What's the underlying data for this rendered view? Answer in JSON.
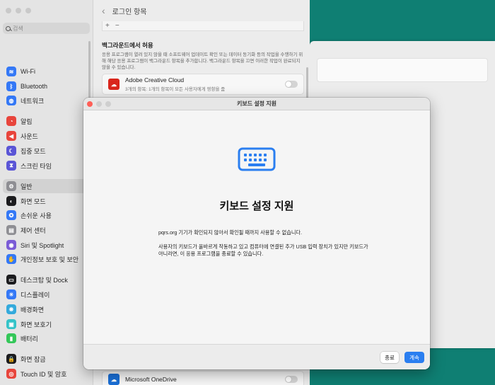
{
  "settings": {
    "search_placeholder": "검색",
    "header_title": "로그인 항목",
    "list_controls": {
      "add": "+",
      "remove": "−"
    },
    "sidebar_items": [
      {
        "label": "Wi-Fi",
        "icon": "wifi-icon",
        "color": "#3478f6",
        "glyph": "≋"
      },
      {
        "label": "Bluetooth",
        "icon": "bluetooth-icon",
        "color": "#3478f6",
        "glyph": "ᛒ"
      },
      {
        "label": "네트워크",
        "icon": "globe-icon",
        "color": "#3478f6",
        "glyph": "◍"
      },
      {
        "label": "알림",
        "icon": "bell-icon",
        "color": "#e8453c",
        "glyph": "◔"
      },
      {
        "label": "사운드",
        "icon": "speaker-icon",
        "color": "#e8453c",
        "glyph": "◀"
      },
      {
        "label": "집중 모드",
        "icon": "moon-icon",
        "color": "#5a55d6",
        "glyph": "☾"
      },
      {
        "label": "스크린 타임",
        "icon": "hourglass-icon",
        "color": "#5a55d6",
        "glyph": "⧗"
      },
      {
        "label": "일반",
        "icon": "gear-icon",
        "color": "#8e8e93",
        "glyph": "⚙"
      },
      {
        "label": "화면 모드",
        "icon": "appearance-icon",
        "color": "#1c1c1e",
        "glyph": "◐"
      },
      {
        "label": "손쉬운 사용",
        "icon": "accessibility-icon",
        "color": "#3478f6",
        "glyph": "✪"
      },
      {
        "label": "제어 센터",
        "icon": "control-center-icon",
        "color": "#8e8e93",
        "glyph": "▤"
      },
      {
        "label": "Siri 및 Spotlight",
        "icon": "siri-icon",
        "color": "#7b5cd6",
        "glyph": "◉"
      },
      {
        "label": "개인정보 보호 및 보안",
        "icon": "hand-icon",
        "color": "#3478f6",
        "glyph": "✋"
      },
      {
        "label": "데스크탑 및 Dock",
        "icon": "dock-icon",
        "color": "#1c1c1e",
        "glyph": "▭"
      },
      {
        "label": "디스플레이",
        "icon": "display-icon",
        "color": "#3478f6",
        "glyph": "☀"
      },
      {
        "label": "배경화면",
        "icon": "wallpaper-icon",
        "color": "#34aadc",
        "glyph": "❋"
      },
      {
        "label": "화면 보호기",
        "icon": "screensaver-icon",
        "color": "#34c3c8",
        "glyph": "▣"
      },
      {
        "label": "배터리",
        "icon": "battery-icon",
        "color": "#34c759",
        "glyph": "▮"
      },
      {
        "label": "화면 잠금",
        "icon": "lock-icon",
        "color": "#1c1c1e",
        "glyph": "🔒"
      },
      {
        "label": "Touch ID 및 암호",
        "icon": "fingerprint-icon",
        "color": "#e8453c",
        "glyph": "◎"
      }
    ],
    "background_section": {
      "title": "백그라운드에서 허용",
      "description": "응용 프로그램이 열려 있지 않을 때 소프트웨어 업데이트 확인 또는 데이터 동기화 등의 작업을 수행하기 위해 해당 응용 프로그램이 백그라운드 항목을 추가합니다. 백그라운드 항목을 끄면 이러한 작업이 완료되지 않을 수 있습니다."
    },
    "adobe_item": {
      "name": "Adobe Creative Cloud",
      "detail": "3개의 항목: 1개의 항목이 모든 사용자에게 영향을 줌",
      "icon": "adobe-icon",
      "color": "#d9261c"
    },
    "onedrive_item": {
      "name": "Microsoft OneDrive",
      "icon": "onedrive-icon",
      "color": "#1a6fd6"
    }
  },
  "dialog": {
    "window_title": "키보드 설정 지원",
    "heading": "키보드 설정 지원",
    "paragraph1": "pqrs.org 기기가 확인되지 않아서 확인될 때까지 사용할 수 없습니다.",
    "paragraph2": "사용자의 키보드가 올바르게 작동하고 있고 컴퓨터에 연결된 추가 USB 입력 장치가 있지만 키보드가 아니라면, 이 응용 프로그램을 종료할 수 있습니다.",
    "quit_label": "종료",
    "continue_label": "계속",
    "icon": "keyboard-icon",
    "accent_color": "#2a7ef0"
  }
}
